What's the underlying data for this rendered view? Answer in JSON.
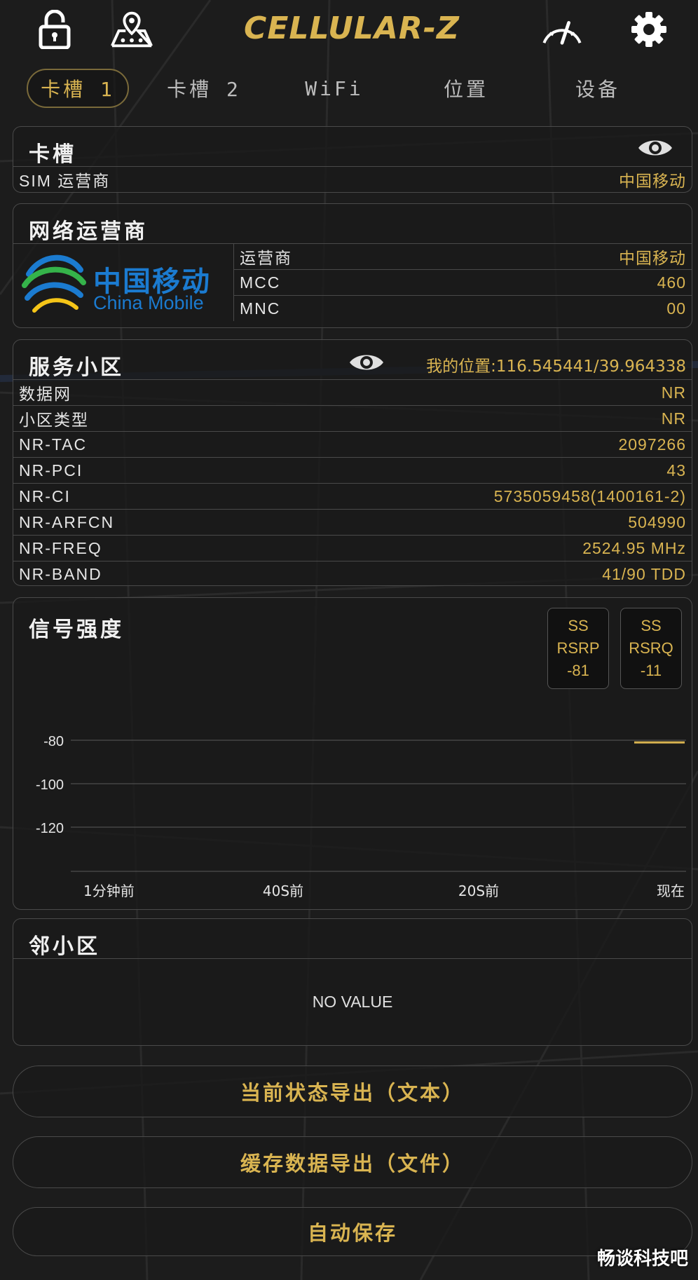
{
  "app": {
    "title": "CELLULAR-Z"
  },
  "tabs": [
    {
      "label": "卡槽 1",
      "active": true
    },
    {
      "label": "卡槽 2",
      "active": false
    },
    {
      "label": "WiFi",
      "active": false
    },
    {
      "label": "位置",
      "active": false
    },
    {
      "label": "设备",
      "active": false
    }
  ],
  "sim_panel": {
    "title": "卡槽",
    "rows": [
      {
        "key": "SIM 运营商",
        "value": "中国移动"
      }
    ]
  },
  "network_panel": {
    "title": "网络运营商",
    "logo": {
      "cn": "中国移动",
      "en": "China Mobile"
    },
    "rows": [
      {
        "key": "运营商",
        "value": "中国移动"
      },
      {
        "key": "MCC",
        "value": "460"
      },
      {
        "key": "MNC",
        "value": "00"
      }
    ]
  },
  "cell_panel": {
    "title": "服务小区",
    "location": "我的位置:116.545441/39.964338",
    "rows": [
      {
        "key": "数据网",
        "value": "NR"
      },
      {
        "key": "小区类型",
        "value": "NR"
      },
      {
        "key": "NR-TAC",
        "value": "2097266"
      },
      {
        "key": "NR-PCI",
        "value": "43"
      },
      {
        "key": "NR-CI",
        "value": "5735059458(1400161-2)"
      },
      {
        "key": "NR-ARFCN",
        "value": "504990"
      },
      {
        "key": "NR-FREQ",
        "value": "2524.95 MHz"
      },
      {
        "key": "NR-BAND",
        "value": "41/90 TDD"
      }
    ]
  },
  "signal_panel": {
    "title": "信号强度",
    "cards": [
      {
        "line1": "SS",
        "line2": "RSRP",
        "value": "-81"
      },
      {
        "line1": "SS",
        "line2": "RSRQ",
        "value": "-11"
      }
    ]
  },
  "chart_data": {
    "type": "line",
    "title": "",
    "y_ticks": [
      "-80",
      "-100",
      "-120"
    ],
    "x_ticks": [
      "1分钟前",
      "40S前",
      "20S前",
      "现在"
    ],
    "series": [
      {
        "values": [
          -81
        ]
      }
    ],
    "color": "#d9b451"
  },
  "neighbor_panel": {
    "title": "邻小区",
    "empty_text": "NO VALUE"
  },
  "buttons": {
    "export_text": "当前状态导出（文本）",
    "export_file": "缓存数据导出（文件）",
    "autosave": "自动保存"
  },
  "watermark": "畅谈科技吧",
  "colors": {
    "accent": "#d9b451",
    "background": "#1c1c1c",
    "border": "#4a4a4a"
  }
}
